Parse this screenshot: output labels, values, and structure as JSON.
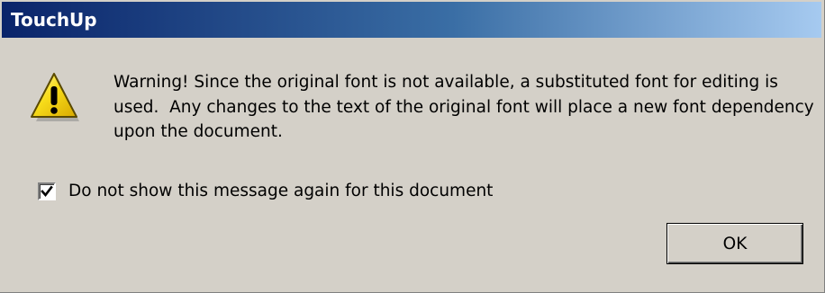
{
  "window": {
    "title": "TouchUp",
    "titlebar_color_start": "#0a246a",
    "titlebar_color_end": "#a6caf0",
    "background_color": "#d4d0c8"
  },
  "message": {
    "icon": "warning-icon",
    "text": "Warning! Since the original font is not available, a substituted font for editing is used.  Any changes to the text of the original font will place a new font dependency upon the document."
  },
  "checkbox": {
    "label": "Do not show this message again for this document",
    "checked": true
  },
  "buttons": {
    "ok_label": "OK"
  }
}
